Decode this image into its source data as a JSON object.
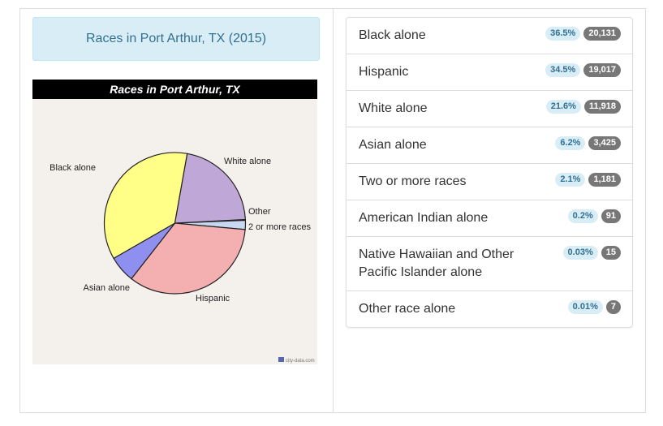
{
  "left": {
    "title": "Races in Port Arthur, TX (2015)"
  },
  "chart_data": {
    "type": "pie",
    "title": "Races in Port Arthur, TX",
    "watermark": "city-data.com",
    "slices": [
      {
        "label": "Black alone",
        "value": 36.5,
        "color": "#ffff88"
      },
      {
        "label": "Hispanic",
        "value": 34.5,
        "color": "#f4b0b0"
      },
      {
        "label": "White alone",
        "value": 21.6,
        "color": "#bfa8d8"
      },
      {
        "label": "Asian alone",
        "value": 6.2,
        "color": "#8f8ff0"
      },
      {
        "label": "2 or more races",
        "value": 2.1,
        "color": "#c8d8f0"
      },
      {
        "label": "Other",
        "value": 0.2,
        "color": "#e05050"
      }
    ]
  },
  "stats": {
    "rows": [
      {
        "label": "Black alone",
        "pct": "36.5%",
        "count": "20,131"
      },
      {
        "label": "Hispanic",
        "pct": "34.5%",
        "count": "19,017"
      },
      {
        "label": "White alone",
        "pct": "21.6%",
        "count": "11,918"
      },
      {
        "label": "Asian alone",
        "pct": "6.2%",
        "count": "3,425"
      },
      {
        "label": "Two or more races",
        "pct": "2.1%",
        "count": "1,181"
      },
      {
        "label": "American Indian alone",
        "pct": "0.2%",
        "count": "91"
      },
      {
        "label": "Native Hawaiian and Other Pacific Islander alone",
        "pct": "0.03%",
        "count": "15"
      },
      {
        "label": "Other race alone",
        "pct": "0.01%",
        "count": "7"
      }
    ]
  }
}
